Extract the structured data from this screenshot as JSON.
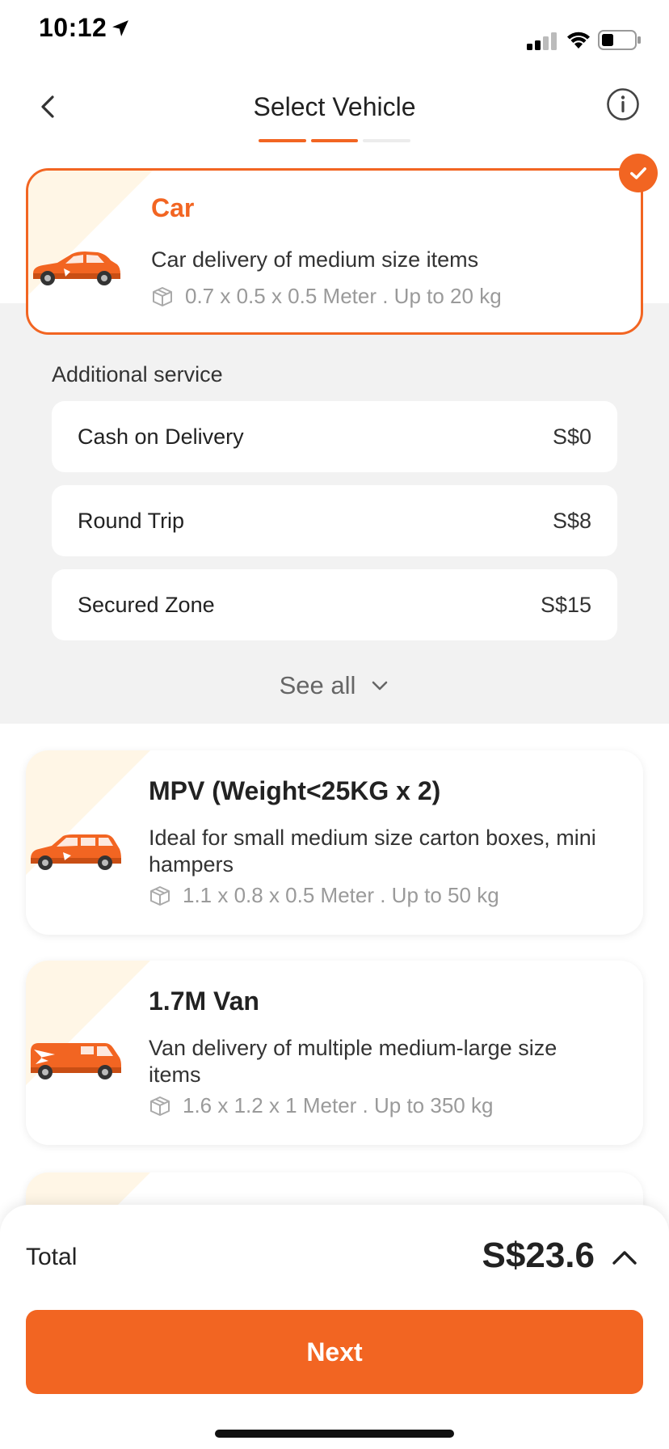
{
  "status_bar": {
    "time": "10:12"
  },
  "header": {
    "title": "Select Vehicle"
  },
  "vehicles": [
    {
      "name": "Car",
      "description": "Car delivery of medium size items",
      "spec": "0.7 x 0.5 x 0.5 Meter . Up to 20 kg",
      "selected": true
    },
    {
      "name": "MPV (Weight<25KG x 2)",
      "description": "Ideal for small medium size carton boxes, mini hampers",
      "spec": "1.1 x 0.8 x 0.5 Meter . Up to 50 kg",
      "selected": false
    },
    {
      "name": "1.7M Van",
      "description": "Van delivery of multiple medium-large size items",
      "spec": "1.6 x 1.2 x 1 Meter . Up to 350 kg",
      "selected": false
    }
  ],
  "additional_service": {
    "label": "Additional service",
    "items": [
      {
        "name": "Cash on Delivery",
        "price": "S$0"
      },
      {
        "name": "Round Trip",
        "price": "S$8"
      },
      {
        "name": "Secured Zone",
        "price": "S$15"
      }
    ],
    "see_all": "See all"
  },
  "footer": {
    "total_label": "Total",
    "total_value": "S$23.6",
    "next_label": "Next"
  },
  "colors": {
    "accent": "#f26522",
    "card_triangle": "#fff6e6",
    "grey_bg": "#f2f2f2"
  }
}
